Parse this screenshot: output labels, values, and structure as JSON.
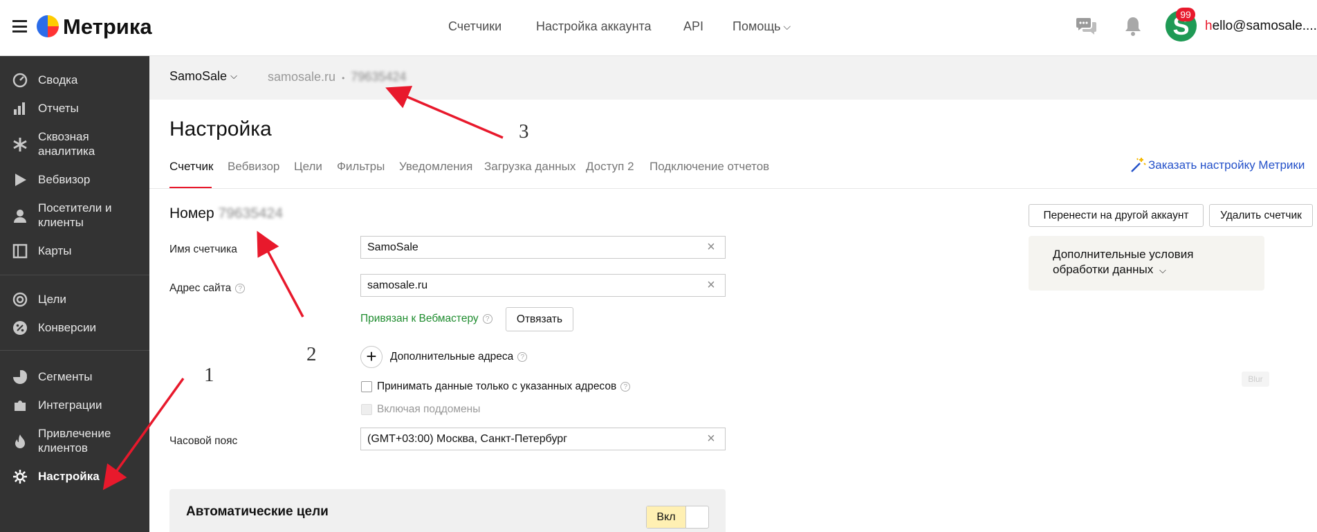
{
  "header": {
    "logo_text": "Метрика",
    "nav": [
      "Счетчики",
      "Настройка аккаунта",
      "API",
      "Помощь"
    ],
    "help_chevron": "⌵",
    "avatar_letter": "S",
    "notifications_badge": "99",
    "user_email_first": "h",
    "user_email_rest": "ello@samosale...."
  },
  "sidebar": {
    "items": [
      {
        "label": "Сводка",
        "icon": "gauge-icon"
      },
      {
        "label": "Отчеты",
        "icon": "bar-chart-icon"
      },
      {
        "label": "Сквозная аналитика",
        "icon": "asterisk-icon"
      },
      {
        "label": "Вебвизор",
        "icon": "play-icon"
      },
      {
        "label": "Посетители и клиенты",
        "icon": "person-icon"
      },
      {
        "label": "Карты",
        "icon": "map-icon"
      },
      {
        "label": "Цели",
        "icon": "target-icon"
      },
      {
        "label": "Конверсии",
        "icon": "percent-icon"
      },
      {
        "label": "Сегменты",
        "icon": "pie-icon"
      },
      {
        "label": "Интеграции",
        "icon": "puzzle-icon"
      },
      {
        "label": "Привлечение клиентов",
        "icon": "flame-icon"
      },
      {
        "label": "Настройка",
        "icon": "gear-icon"
      }
    ],
    "active": "Настройка"
  },
  "subheader": {
    "project": "SamoSale",
    "site": "samosale.ru",
    "separator": "•",
    "counter_id": "79635424"
  },
  "page": {
    "title": "Настройка",
    "tabs": [
      "Счетчик",
      "Вебвизор",
      "Цели",
      "Фильтры",
      "Уведомления",
      "Загрузка данных",
      "Доступ 2",
      "Подключение отчетов"
    ],
    "active_tab": "Счетчик",
    "order_link": "Заказать настройку Метрики"
  },
  "form": {
    "number_label": "Номер",
    "number_value": "79635424",
    "name_label": "Имя счетчика",
    "name_value": "SamoSale",
    "site_label": "Адрес сайта",
    "site_value": "samosale.ru",
    "webmaster_status": "Привязан к Вебмастеру",
    "unlink_button": "Отвязать",
    "extra_addresses": "Дополнительные адреса",
    "only_listed_label": "Принимать данные только с указанных адресов",
    "subdomains_label": "Включая поддомены",
    "timezone_label": "Часовой пояс",
    "timezone_value": "(GMT+03:00) Москва, Санкт-Петербург",
    "help_glyph": "?"
  },
  "actions": {
    "transfer_button": "Перенести на другой аккаунт",
    "delete_button": "Удалить счетчик",
    "extra_conditions": "Дополнительные условия обработки данных"
  },
  "blur_tag": "Blur",
  "auto_goals": {
    "title": "Автоматические цели",
    "toggle_on": "Вкл"
  },
  "annotations": [
    "1",
    "2",
    "3"
  ],
  "colors": {
    "accent_red": "#e8192c",
    "sidebar_bg": "#333333",
    "link_blue": "#2350c9",
    "success_green": "#1e8c2e",
    "arrow_red": "#e8192c"
  }
}
